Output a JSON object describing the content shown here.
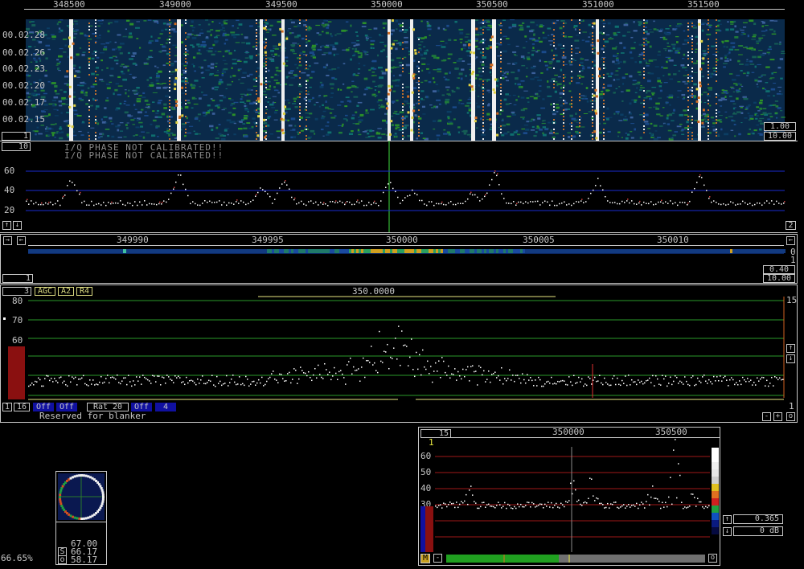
{
  "wide_graph": {
    "freq_ticks": [
      "348500",
      "349000",
      "349500",
      "350000",
      "350500",
      "351000",
      "351500"
    ],
    "time_labels": [
      "00.02.28",
      "00.02.26",
      "00.02.23",
      "00.02.20",
      "00.02.17",
      "00.02.15"
    ],
    "avg_box": "1",
    "gain_value": "1.00",
    "zero_value": "10.00",
    "spectrum_avg_box": "10",
    "warning_line1": "I/Q PHASE NOT CALIBRATED!!",
    "warning_line2": "I/Q PHASE NOT CALIBRATED!!",
    "y_labels": [
      "60",
      "40",
      "20"
    ],
    "right_box": "2"
  },
  "hires_graph": {
    "freq_ticks": [
      "349990",
      "349995",
      "350000",
      "350005",
      "350010"
    ],
    "right_val_0": "0",
    "right_val_1": "1",
    "gain_value": "0.40",
    "zero_value": "10.00",
    "left_box": "1"
  },
  "baseband_graph": {
    "box_3": "3",
    "agc_label": "AGC",
    "a2_label": "A2",
    "r4_label": "R4",
    "center_freq": "350.0000",
    "y_labels": [
      "80",
      "70",
      "60",
      "50",
      "40"
    ],
    "right_top_value": "15",
    "right_bottom_value": "1",
    "bottom_box_1": "1",
    "bottom_box_16": "16",
    "off1": "Off",
    "off2": "Off",
    "rat_label": "Rat 20",
    "off3": "Off",
    "box_4": "4",
    "status_text": "Reserved for blanker",
    "minus_btn": "-",
    "plus_btn": "+",
    "o_btn": "o"
  },
  "phasing_graph": {
    "val1": "67.00",
    "s_label": "S",
    "val2": "66.17",
    "o_label": "o",
    "val3": "58.17"
  },
  "cpu_load": "66.65%",
  "afc_graph": {
    "box_15": "15",
    "freq_ticks": [
      "350000",
      "350500"
    ],
    "marker_1": "1",
    "y_labels": [
      "60",
      "50",
      "40",
      "30",
      "20",
      "10"
    ],
    "value_1": "0.365",
    "value_2": "0 dB",
    "m_btn": "M",
    "minus_btn": "-",
    "o_btn": "o"
  },
  "colors": {
    "grid_blue": "#1a2bd0",
    "grid_green": "#2a9a2a",
    "grid_red": "#a01818",
    "marker_green": "#40e040",
    "bar_green": "#20a020",
    "bar_gray": "#707070"
  }
}
